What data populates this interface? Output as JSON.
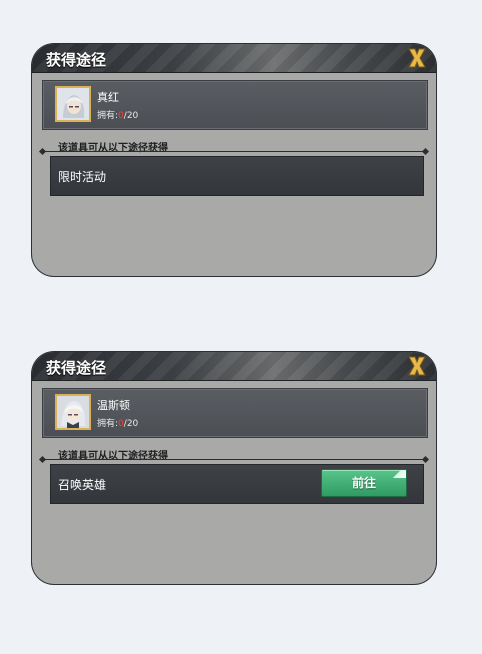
{
  "panels": [
    {
      "title": "获得途径",
      "item": {
        "name": "真红",
        "count_prefix": "拥有:",
        "count_owned": "0",
        "count_total": "/20"
      },
      "section_label": "该道具可从以下途径获得",
      "source": {
        "label": "限时活动"
      }
    },
    {
      "title": "获得途径",
      "item": {
        "name": "温斯顿",
        "count_prefix": "拥有:",
        "count_owned": "0",
        "count_total": "/20"
      },
      "section_label": "该道具可从以下途径获得",
      "source": {
        "label": "召唤英雄",
        "button_label": "前往"
      }
    }
  ],
  "colors": {
    "panel_bg": "#a9aaa8",
    "owned_count": "#ff3b3b",
    "go_button": "#3fae72"
  },
  "icons": {
    "close": "close-x-icon",
    "item_portrait_1": "hero-portrait-icon",
    "item_portrait_2": "hero-portrait-icon"
  }
}
